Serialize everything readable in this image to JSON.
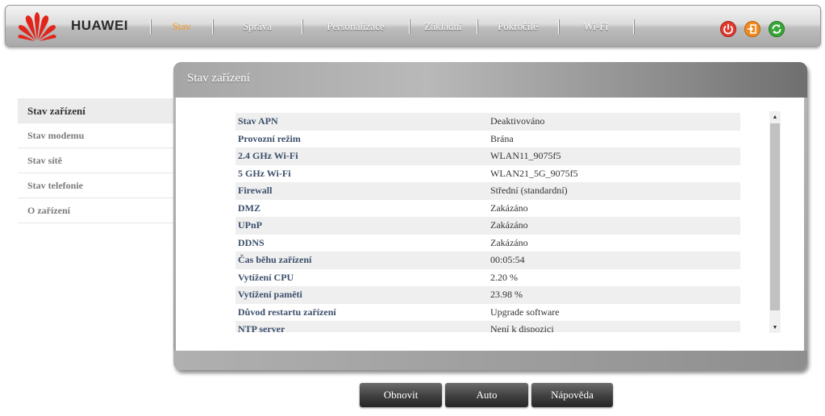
{
  "brand": "HUAWEI",
  "nav": [
    "Stav",
    "Správa",
    "Personalizace",
    "Základní",
    "Pokročilé",
    "Wi-Fi"
  ],
  "nav_active_color": "#f59a23",
  "controls": [
    {
      "icon": "power-icon",
      "color": "#e0392e"
    },
    {
      "icon": "logout-icon",
      "color": "#f08c1e"
    },
    {
      "icon": "refresh-icon",
      "color": "#3aa63a"
    }
  ],
  "sidebar": [
    "Stav zařízení",
    "Stav modemu",
    "Stav sítě",
    "Stav telefonie",
    "O zařízení"
  ],
  "panel": {
    "title": "Stav zařízení"
  },
  "rows": [
    {
      "k": "Stav APN",
      "v": "Deaktivováno"
    },
    {
      "k": "Provozní režim",
      "v": "Brána"
    },
    {
      "k": "2.4 GHz Wi-Fi",
      "v": "WLAN11_9075f5"
    },
    {
      "k": "5 GHz Wi-Fi",
      "v": "WLAN21_5G_9075f5"
    },
    {
      "k": "Firewall",
      "v": "Střední (standardní)"
    },
    {
      "k": "DMZ",
      "v": "Zakázáno"
    },
    {
      "k": "UPnP",
      "v": "Zakázáno"
    },
    {
      "k": "DDNS",
      "v": "Zakázáno"
    },
    {
      "k": "Čas běhu zařízení",
      "v": "00:05:54"
    },
    {
      "k": "Vytížení CPU",
      "v": "2.20 %"
    },
    {
      "k": "Vytížení paměti",
      "v": "23.98 %"
    },
    {
      "k": "Důvod restartu zařízení",
      "v": "Upgrade software"
    },
    {
      "k": "NTP server",
      "v": "Není k dispozici"
    }
  ],
  "buttons": {
    "refresh": "Obnovit",
    "auto": "Auto",
    "help": "Nápověda"
  }
}
